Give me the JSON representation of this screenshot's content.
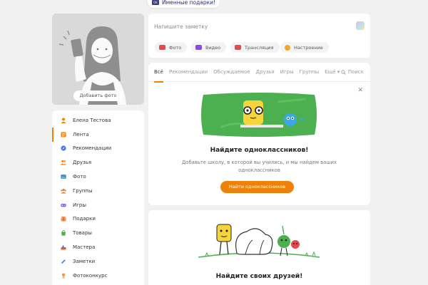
{
  "top_tag": {
    "label": "Именные подарки!",
    "icon": "gift-tag-icon"
  },
  "avatar": {
    "add_photo_label": "Добавить фото"
  },
  "menu": {
    "items": [
      {
        "label": "Елена Тестова",
        "icon": "user-icon",
        "color": "#ee8208"
      },
      {
        "label": "Лента",
        "icon": "feed-icon",
        "color": "#ee8208",
        "active": true
      },
      {
        "label": "Рекомендации",
        "icon": "compass-icon",
        "color": "#3b7de0"
      },
      {
        "label": "Друзья",
        "icon": "friends-icon",
        "color": "#ee8208"
      },
      {
        "label": "Фото",
        "icon": "photo-icon",
        "color": "#4a90d9"
      },
      {
        "label": "Группы",
        "icon": "groups-icon",
        "color": "#e07a3b"
      },
      {
        "label": "Игры",
        "icon": "gamepad-icon",
        "color": "#8b5cf6"
      },
      {
        "label": "Подарки",
        "icon": "gift-icon",
        "color": "#e8a03a"
      },
      {
        "label": "Товары",
        "icon": "bag-icon",
        "color": "#4caf50"
      },
      {
        "label": "Мастера",
        "icon": "tools-icon",
        "color": "#e05a3b"
      },
      {
        "label": "Заметки",
        "icon": "pencil-icon",
        "color": "#3b7de0"
      },
      {
        "label": "Фотоконкурс",
        "icon": "trophy-icon",
        "color": "#e8a03a"
      }
    ]
  },
  "composer": {
    "placeholder": "Напишите заметку",
    "chips": [
      {
        "label": "Фото",
        "icon": "camera-icon",
        "color": "#e5484d"
      },
      {
        "label": "Видео",
        "icon": "video-icon",
        "color": "#8b4be0"
      },
      {
        "label": "Трансляция",
        "icon": "live-icon",
        "color": "#e5484d"
      },
      {
        "label": "Настроение",
        "icon": "mood-icon",
        "color": "#f2a629"
      }
    ]
  },
  "feed": {
    "tabs": [
      "Всё",
      "Рекомендации",
      "Обсуждаемое",
      "Друзья",
      "Игры",
      "Группы",
      "Ещё ▾"
    ],
    "active_tab": "Всё",
    "search_label": "Поиск",
    "find_classmates": {
      "title": "Найдите одноклассников!",
      "description": "Добавьте школу, в которой вы учились, и мы найдем ваших одноклассников",
      "button": "Найти одноклассников"
    },
    "find_friends": {
      "title": "Найдите своих друзей!"
    }
  },
  "colors": {
    "accent": "#ee8208",
    "background": "#f1f1f1",
    "card": "#ffffff"
  }
}
